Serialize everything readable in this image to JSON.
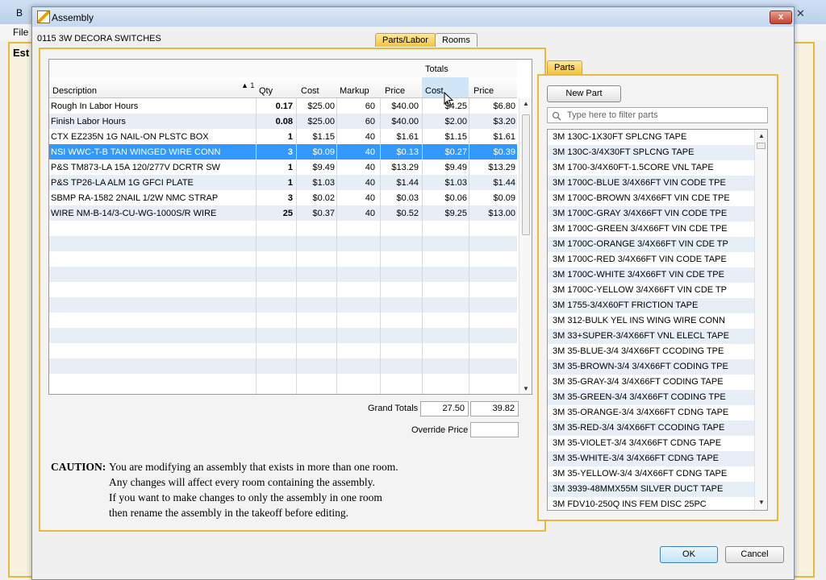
{
  "background_app": {
    "title": "B",
    "menu_file": "File",
    "tab_label": "Est"
  },
  "dialog": {
    "title": "Assembly",
    "close_label": "x",
    "assembly_name": "0115 3W DECORA SWITCHES",
    "tabs": [
      {
        "label": "Parts/Labor"
      },
      {
        "label": "Rooms"
      }
    ]
  },
  "grid": {
    "totals_label": "Totals",
    "headers": {
      "description": "Description",
      "qty": "Qty",
      "cost": "Cost",
      "markup": "Markup",
      "price": "Price",
      "total_cost": "Cost",
      "total_price": "Price"
    },
    "sort_indicator": "▲ 1",
    "rows": [
      {
        "description": "Rough In Labor Hours",
        "qty": "0.17",
        "cost": "$25.00",
        "markup": "60",
        "price": "$40.00",
        "total_cost": "$4.25",
        "total_price": "$6.80"
      },
      {
        "description": "Finish Labor Hours",
        "qty": "0.08",
        "cost": "$25.00",
        "markup": "60",
        "price": "$40.00",
        "total_cost": "$2.00",
        "total_price": "$3.20"
      },
      {
        "description": "CTX EZ235N 1G NAIL-ON PLSTC BOX",
        "qty": "1",
        "cost": "$1.15",
        "markup": "40",
        "price": "$1.61",
        "total_cost": "$1.15",
        "total_price": "$1.61"
      },
      {
        "description": "NSI WWC-T-B TAN WINGED WIRE CONN",
        "qty": "3",
        "cost": "$0.09",
        "markup": "40",
        "price": "$0.13",
        "total_cost": "$0.27",
        "total_price": "$0.39"
      },
      {
        "description": "P&S TM873-LA 15A 120/277V DCRTR SW",
        "qty": "1",
        "cost": "$9.49",
        "markup": "40",
        "price": "$13.29",
        "total_cost": "$9.49",
        "total_price": "$13.29"
      },
      {
        "description": "P&S TP26-LA ALM 1G GFCI PLATE",
        "qty": "1",
        "cost": "$1.03",
        "markup": "40",
        "price": "$1.44",
        "total_cost": "$1.03",
        "total_price": "$1.44"
      },
      {
        "description": "SBMP RA-1582 2NAIL 1/2W NMC STRAP",
        "qty": "3",
        "cost": "$0.02",
        "markup": "40",
        "price": "$0.03",
        "total_cost": "$0.06",
        "total_price": "$0.09"
      },
      {
        "description": "WIRE NM-B-14/3-CU-WG-1000S/R WIRE",
        "qty": "25",
        "cost": "$0.37",
        "markup": "40",
        "price": "$0.52",
        "total_cost": "$9.25",
        "total_price": "$13.00"
      }
    ]
  },
  "totals": {
    "grand_label": "Grand Totals",
    "grand_cost": "27.50",
    "grand_price": "39.82",
    "override_label": "Override Price",
    "override_value": ""
  },
  "caution": {
    "heading": "CAUTION:",
    "lines": [
      "You are modifying an assembly that exists in more than one room.",
      "Any changes will affect every room containing the assembly.",
      "If you want to make changes to only the assembly in one room",
      "then rename the assembly in the takeoff before editing."
    ]
  },
  "parts": {
    "tab_label": "Parts",
    "new_part_label": "New Part",
    "filter_placeholder": "Type here to filter parts",
    "items": [
      "3M 130C-1X30FT SPLCNG TAPE",
      "3M 130C-3/4X30FT SPLCNG TAPE",
      "3M 1700-3/4X60FT-1.5CORE VNL TAPE",
      "3M 1700C-BLUE 3/4X66FT VIN CODE TPE",
      "3M 1700C-BROWN 3/4X66FT VIN CDE TPE",
      "3M 1700C-GRAY 3/4X66FT VIN CODE TPE",
      "3M 1700C-GREEN 3/4X66FT VIN CDE TPE",
      "3M 1700C-ORANGE 3/4X66FT VIN CDE TP",
      "3M 1700C-RED 3/4X66FT VIN CODE TAPE",
      "3M 1700C-WHITE 3/4X66FT VIN CDE TPE",
      "3M 1700C-YELLOW 3/4X66FT VIN CDE TP",
      "3M 1755-3/4X60FT FRICTION TAPE",
      "3M 312-BULK YEL INS WING WIRE CONN",
      "3M 33+SUPER-3/4X66FT VNL ELECL TAPE",
      "3M 35-BLUE-3/4 3/4X66FT CCODING TPE",
      "3M 35-BROWN-3/4 3/4X66FT CODING TPE",
      "3M 35-GRAY-3/4 3/4X66FT CODING TAPE",
      "3M 35-GREEN-3/4 3/4X66FT CODING TPE",
      "3M 35-ORANGE-3/4 3/4X66FT CDNG TAPE",
      "3M 35-RED-3/4 3/4X66FT CCODING TAPE",
      "3M 35-VIOLET-3/4 3/4X66FT CDNG TAPE",
      "3M 35-WHITE-3/4 3/4X66FT CDNG TAPE",
      "3M 35-YELLOW-3/4 3/4X66FT CDNG TAPE",
      "3M 3939-48MMX55M SILVER DUCT TAPE",
      "3M FDV10-250Q INS FEM DISC 25PC"
    ]
  },
  "buttons": {
    "ok": "OK",
    "cancel": "Cancel"
  },
  "colors": {
    "accent_gold": "#e8b93a",
    "selection_blue": "#3399ff",
    "row_alt": "#e8eef6"
  },
  "icons": [
    "app-icon",
    "close-icon",
    "search-icon",
    "sort-ascending-icon",
    "scroll-up-icon",
    "scroll-down-icon",
    "mouse-cursor-icon"
  ]
}
